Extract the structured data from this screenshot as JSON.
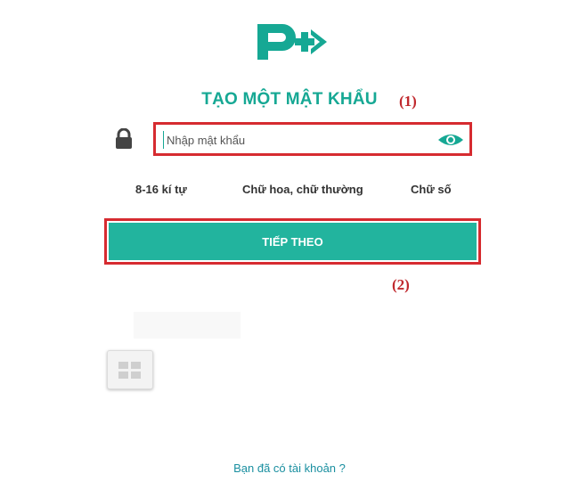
{
  "brand": {
    "logo_icon": "pharmacy-logo-icon",
    "color": "#16a894"
  },
  "screen": {
    "title": "TẠO MỘT MẬT KHẨU"
  },
  "annotations": {
    "step1": "(1)",
    "step2": "(2)",
    "color": "#c0282d"
  },
  "password": {
    "icon": "lock-icon",
    "placeholder": "Nhập mật khẩu",
    "value": "",
    "toggle_icon": "eye-icon"
  },
  "rules": [
    "8-16 kí tự",
    "Chữ hoa, chữ thường",
    "Chữ số"
  ],
  "next_button": {
    "label": "TIẾP THEO",
    "color": "#22b49e"
  },
  "floating_menu": {
    "icon": "grid-icon"
  },
  "footer": {
    "have_account_link": "Bạn đã có tài khoản ?"
  }
}
